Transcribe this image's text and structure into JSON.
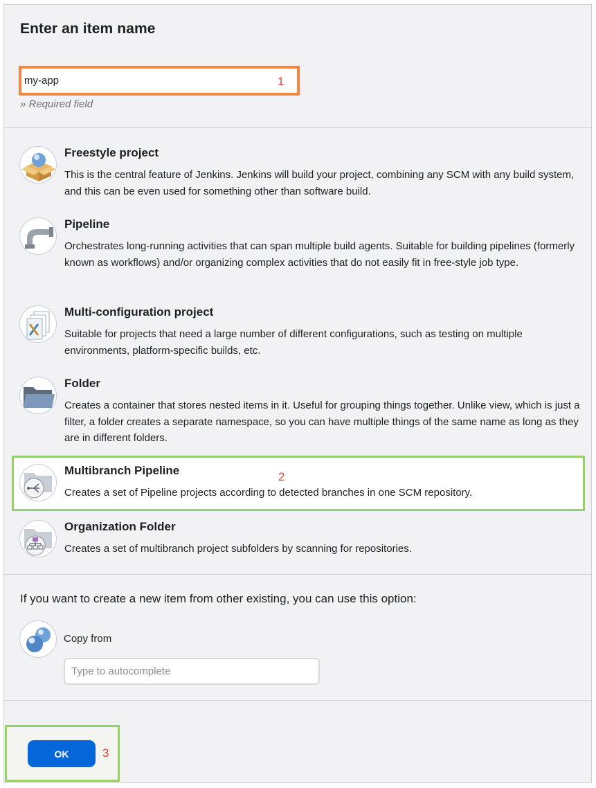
{
  "header": {
    "title": "Enter an item name"
  },
  "item_name": {
    "value": "my-app",
    "required_hint": "» Required field"
  },
  "callouts": {
    "one": "1",
    "two": "2",
    "three": "3"
  },
  "item_types": [
    {
      "title": "Freestyle project",
      "description": "This is the central feature of Jenkins. Jenkins will build your project, combining any SCM with any build system, and this can be even used for something other than software build.",
      "icon": "freestyle-box-icon"
    },
    {
      "title": "Pipeline",
      "description": "Orchestrates long-running activities that can span multiple build agents. Suitable for building pipelines (formerly known as workflows) and/or organizing complex activities that do not easily fit in free-style job type.",
      "icon": "pipe-icon"
    },
    {
      "title": "Multi-configuration project",
      "description": "Suitable for projects that need a large number of different configurations, such as testing on multiple environments, platform-specific builds, etc.",
      "icon": "documents-icon"
    },
    {
      "title": "Folder",
      "description": "Creates a container that stores nested items in it. Useful for grouping things together. Unlike view, which is just a filter, a folder creates a separate namespace, so you can have multiple things of the same name as long as they are in different folders.",
      "icon": "folder-icon"
    },
    {
      "title": "Multibranch Pipeline",
      "description": "Creates a set of Pipeline projects according to detected branches in one SCM repository.",
      "icon": "branch-folder-icon"
    },
    {
      "title": "Organization Folder",
      "description": "Creates a set of multibranch project subfolders by scanning for repositories.",
      "icon": "org-tree-icon"
    }
  ],
  "copy": {
    "intro": "If you want to create a new item from other existing, you can use this option:",
    "label": "Copy from",
    "placeholder": "Type to autocomplete",
    "icon": "copy-spheres-icon"
  },
  "actions": {
    "ok_label": "OK"
  },
  "colors": {
    "name_highlight": "#f58542",
    "step_highlight": "#97d067",
    "ok_button": "#0466d9",
    "callout_text": "#e8433b"
  }
}
